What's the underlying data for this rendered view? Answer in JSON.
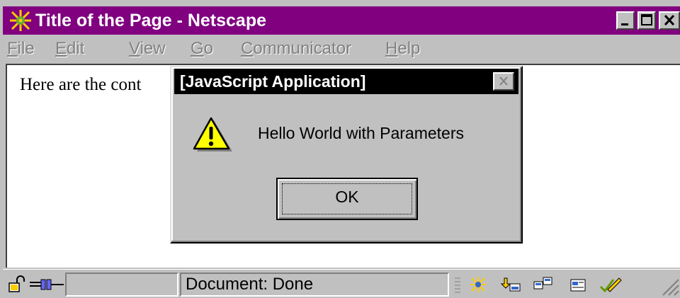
{
  "window": {
    "title": "Title of the Page - Netscape"
  },
  "menu": {
    "items": [
      {
        "mnemonic": "F",
        "rest": "ile"
      },
      {
        "mnemonic": "E",
        "rest": "dit"
      },
      {
        "mnemonic": "V",
        "rest": "iew"
      },
      {
        "mnemonic": "G",
        "rest": "o"
      },
      {
        "mnemonic": "C",
        "rest": "ommunicator"
      },
      {
        "mnemonic": "H",
        "rest": "elp"
      }
    ]
  },
  "content": {
    "text": "Here are the cont"
  },
  "dialog": {
    "title": "[JavaScript Application]",
    "message": "Hello World with Parameters",
    "ok_label": "OK",
    "icon": "warning-icon"
  },
  "status": {
    "text": "Document: Done",
    "icons": [
      "lock-icon",
      "connection-icon",
      "navigator-icon",
      "mailbox-icon",
      "discussion-icon",
      "composer-icon",
      "editor-icon"
    ]
  },
  "colors": {
    "titlebar": "#800080",
    "dialog_titlebar": "#000000",
    "chrome": "#c0c0c0"
  }
}
